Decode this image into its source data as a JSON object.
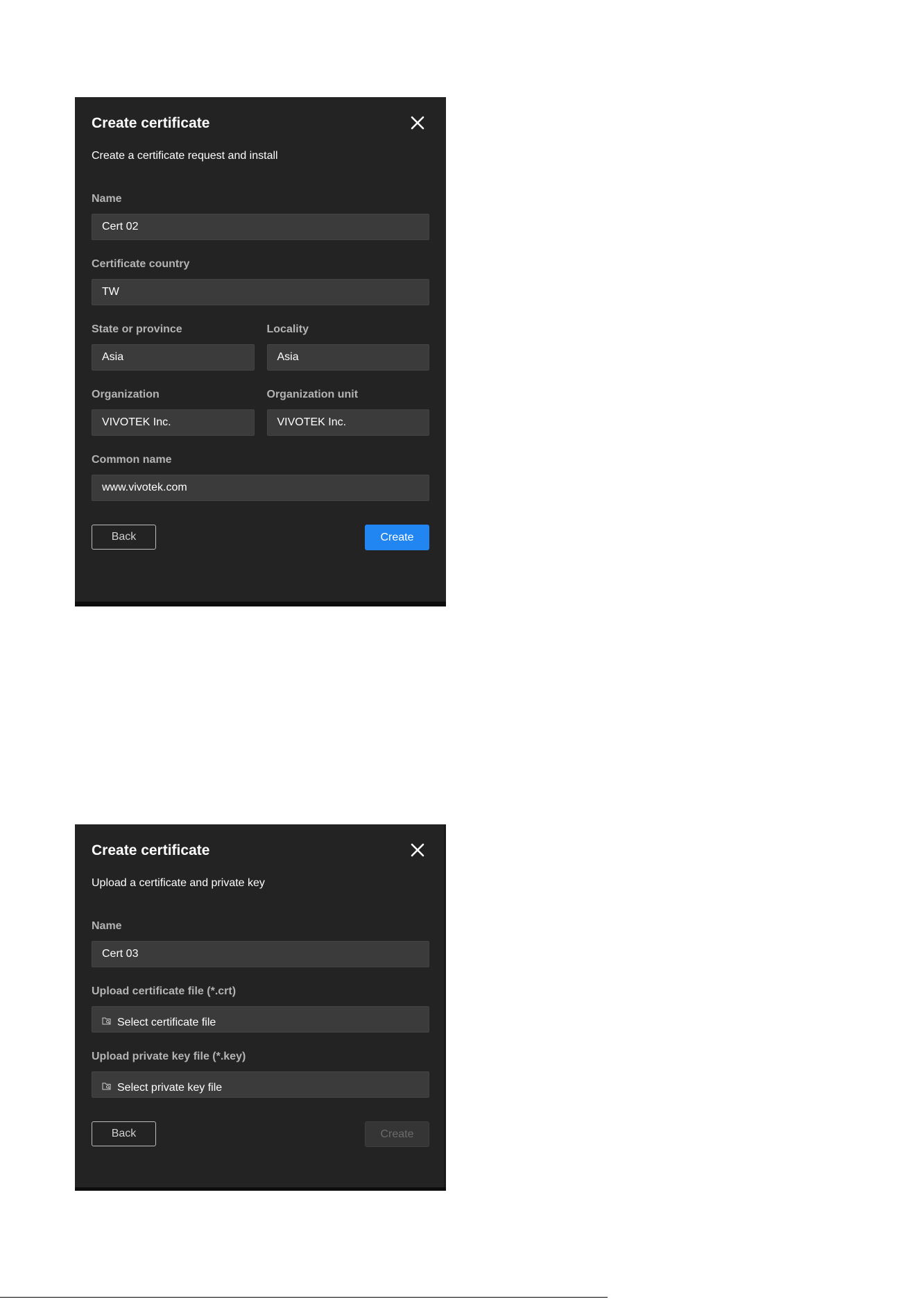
{
  "dialog1": {
    "title": "Create certificate",
    "subtitle": "Create a certificate request and install",
    "fields": {
      "name": {
        "label": "Name",
        "value": "Cert 02"
      },
      "country": {
        "label": "Certificate country",
        "value": "TW"
      },
      "state": {
        "label": "State or province",
        "value": "Asia"
      },
      "locality": {
        "label": "Locality",
        "value": "Asia"
      },
      "organization": {
        "label": "Organization",
        "value": "VIVOTEK Inc."
      },
      "org_unit": {
        "label": "Organization unit",
        "value": "VIVOTEK Inc."
      },
      "common_name": {
        "label": "Common name",
        "value": "www.vivotek.com"
      }
    },
    "back_label": "Back",
    "create_label": "Create",
    "create_color": "#2186f2"
  },
  "dialog2": {
    "title": "Create certificate",
    "subtitle": "Upload a certificate and private key",
    "fields": {
      "name": {
        "label": "Name",
        "value": "Cert 03"
      },
      "cert_file": {
        "label": "Upload certificate file (*.crt)",
        "placeholder": "Select certificate file"
      },
      "key_file": {
        "label": "Upload private key file (*.key)",
        "placeholder": "Select private key file"
      }
    },
    "back_label": "Back",
    "create_label": "Create",
    "create_state": "disabled"
  },
  "icons": {
    "close": "close-icon",
    "file": "folder-search-icon"
  },
  "colors": {
    "dialog_bg": "#232323",
    "input_bg": "#3b3b3b",
    "label": "#b4b4b4"
  }
}
